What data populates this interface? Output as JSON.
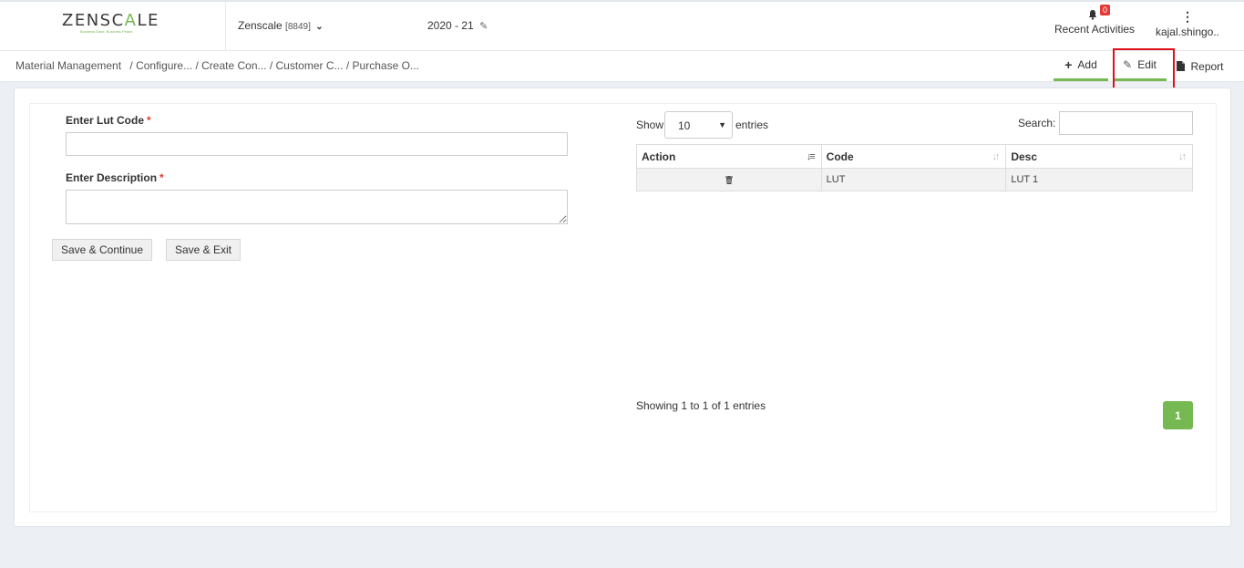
{
  "header": {
    "logo_text_a": "ZENSC",
    "logo_text_b": "A",
    "logo_text_c": "LE",
    "logo_tagline": "Business Ease. Business Peace.",
    "company_name": "Zenscale",
    "company_code": "[8849]",
    "fiscal_year": "2020 - 21",
    "notification_count": "0",
    "notifications_label": "Recent Activities",
    "user_name": "kajal.shingo.."
  },
  "breadcrumb": {
    "items": [
      "Material Management",
      "/ Configure...",
      "/ Create Con...",
      "/ Customer C...",
      "/ Purchase O..."
    ]
  },
  "toolbar": {
    "add_label": "Add",
    "edit_label": "Edit",
    "report_label": "Report"
  },
  "form": {
    "lut_code_label": "Enter Lut Code",
    "lut_code_value": "",
    "description_label": "Enter Description",
    "description_value": "",
    "required_mark": "*",
    "save_continue_label": "Save & Continue",
    "save_exit_label": "Save & Exit"
  },
  "table": {
    "show_label": "Show",
    "page_size": "10",
    "entries_label": "entries",
    "search_label": "Search:",
    "search_value": "",
    "columns": [
      "Action",
      "Code",
      "Desc"
    ],
    "rows": [
      {
        "code": "LUT",
        "desc": "LUT 1"
      }
    ],
    "info": "Showing 1 to 1 of 1 entries",
    "current_page": "1"
  },
  "colors": {
    "accent": "#76b852",
    "highlight": "#e0101a",
    "badge": "#e53935"
  }
}
